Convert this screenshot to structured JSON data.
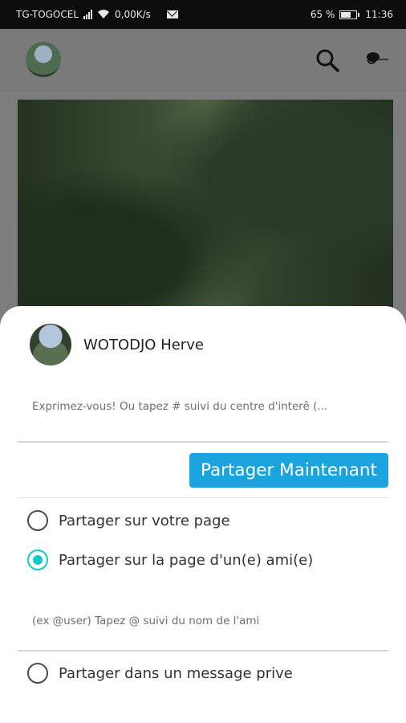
{
  "status_bar": {
    "carrier": "TG-TOGOCEL",
    "data_speed": "0,00K/s",
    "battery_percent": "65 %",
    "time": "11:36",
    "icons": [
      "signal-icon",
      "wifi-icon",
      "mail-icon",
      "battery-icon"
    ]
  },
  "app_bar": {
    "icons": [
      "avatar",
      "search-icon",
      "profile-mini-icon"
    ]
  },
  "share_sheet": {
    "user_name": "WOTODJO Herve",
    "compose_placeholder": "Exprimez-vous! Ou tapez # suivi du centre d'interê (...",
    "share_now_label": "Partager Maintenant",
    "options": [
      {
        "label": "Partager sur votre page",
        "checked": false
      },
      {
        "label": "Partager sur la page d'un(e) ami(e)",
        "checked": true
      },
      {
        "label": "Partager dans un message prive",
        "checked": false
      }
    ],
    "friend_placeholder": "(ex @user) Tapez @ suivi du nom de l'ami"
  },
  "colors": {
    "accent_button": "#1aa3dd",
    "radio_checked": "#14c7cc",
    "overlay": "#7d7d7d"
  }
}
